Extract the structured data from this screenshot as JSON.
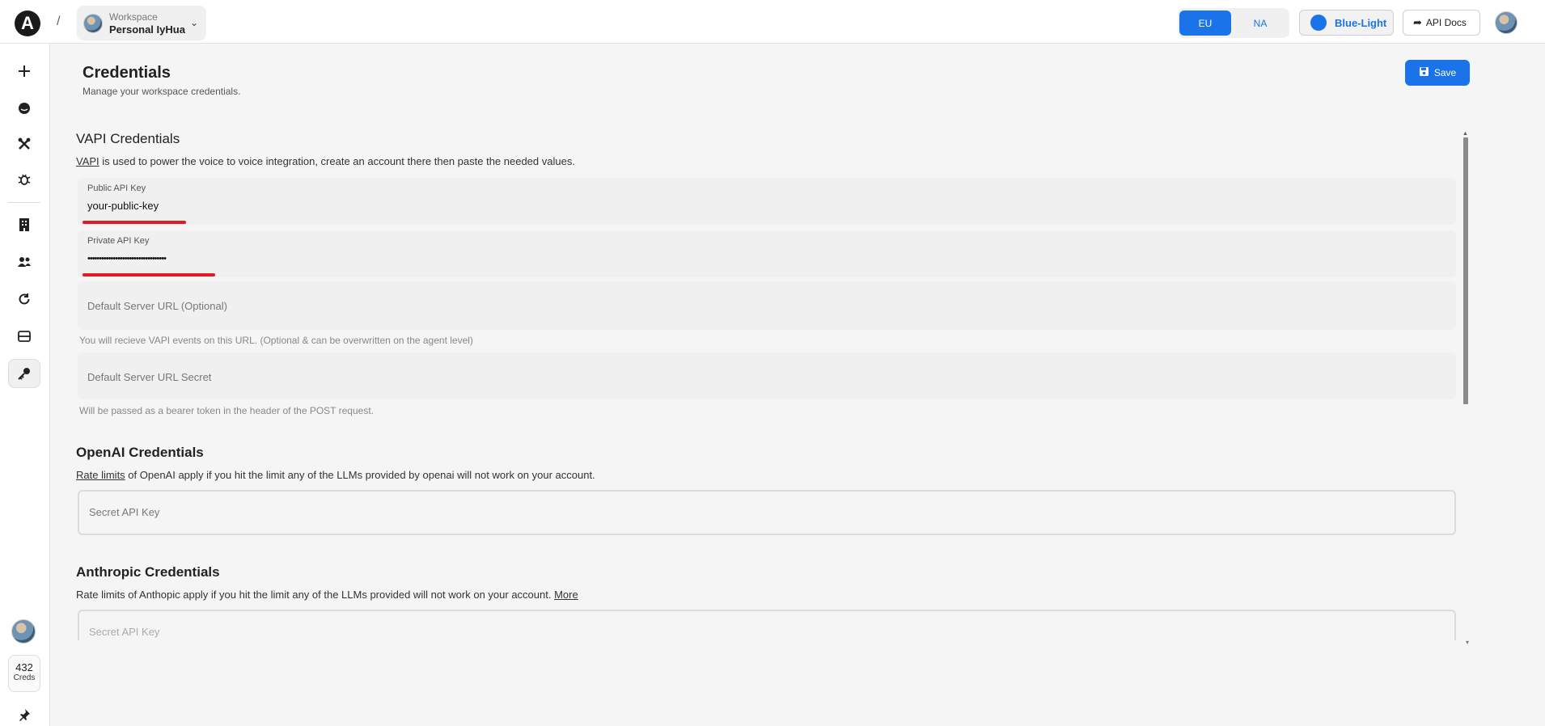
{
  "topbar": {
    "logo_letter": "A",
    "separator": "/",
    "workspace_label": "Workspace",
    "workspace_name": "Personal IyHua",
    "region_eu": "EU",
    "region_na": "NA",
    "theme_label": "Blue-Light",
    "api_docs_label": "API Docs"
  },
  "sidebar": {
    "icons": [
      "plus-icon",
      "chat-icon",
      "tools-icon",
      "bug-icon",
      "building-icon",
      "users-icon",
      "refresh-icon",
      "database-icon",
      "key-icon"
    ],
    "creds_count": "432",
    "creds_label": "Creds"
  },
  "page": {
    "title": "Credentials",
    "subtitle": "Manage your workspace credentials.",
    "save_label": "Save"
  },
  "vapi": {
    "title": "VAPI Credentials",
    "desc_link": "VAPI",
    "desc_rest": " is used to power the voice to voice integration, create an account there then paste the needed values.",
    "public_key_label": "Public API Key",
    "public_key_value": "your-public-key",
    "private_key_label": "Private API Key",
    "private_key_value": "••••••••••••••••••••••••••••••••••",
    "server_url_placeholder": "Default Server URL (Optional)",
    "server_url_hint": "You will recieve VAPI events on this URL. (Optional & can be overwritten on the agent level)",
    "server_secret_placeholder": "Default Server URL Secret",
    "server_secret_hint": "Will be passed as a bearer token in the header of the POST request."
  },
  "openai": {
    "title": "OpenAI Credentials",
    "desc_link": "Rate limits",
    "desc_rest": " of OpenAI apply if you hit the limit any of the LLMs provided by openai will not work on your account.",
    "secret_placeholder": "Secret API Key"
  },
  "anthropic": {
    "title": "Anthropic Credentials",
    "desc_rest": "Rate limits of Anthopic apply if you hit the limit any of the LLMs provided will not work on your account. ",
    "desc_link": "More",
    "secret_placeholder": "Secret API Key"
  },
  "colors": {
    "accent": "#1a73e8",
    "annotation": "#e01b24"
  }
}
